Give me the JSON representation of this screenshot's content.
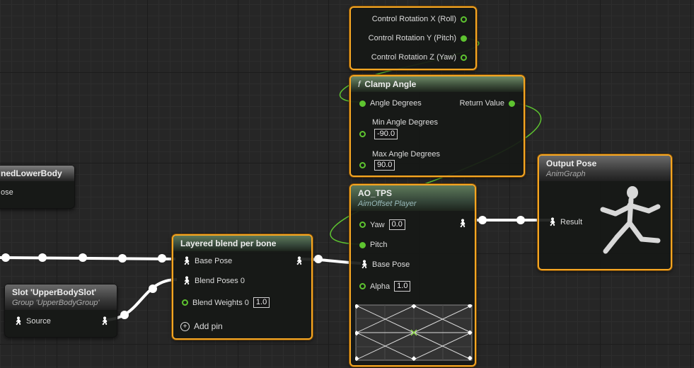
{
  "nodes": {
    "control_rotation": {
      "pins": [
        "Control Rotation X (Roll)",
        "Control Rotation Y (Pitch)",
        "Control Rotation Z (Yaw)"
      ]
    },
    "clamp_angle": {
      "title": "Clamp Angle",
      "function_glyph": "f",
      "angle_degrees": "Angle Degrees",
      "return_value": "Return Value",
      "min_label": "Min Angle Degrees",
      "min_value": "-90.0",
      "max_label": "Max Angle Degrees",
      "max_value": "90.0"
    },
    "lower_body": {
      "title": "nedLowerBody",
      "pin": "ose"
    },
    "output_pose": {
      "title": "Output Pose",
      "subtitle": "AnimGraph",
      "result": "Result"
    },
    "ao_tps": {
      "title": "AO_TPS",
      "subtitle": "AimOffset Player",
      "yaw_label": "Yaw",
      "yaw_value": "0.0",
      "pitch_label": "Pitch",
      "base_pose": "Base Pose",
      "alpha_label": "Alpha",
      "alpha_value": "1.0"
    },
    "layered_blend": {
      "title": "Layered blend per bone",
      "base_pose": "Base Pose",
      "blend_poses": "Blend Poses 0",
      "blend_weights": "Blend Weights 0",
      "blend_weights_value": "1.0",
      "add_pin": "Add pin"
    },
    "slot": {
      "title": "Slot 'UpperBodySlot'",
      "subtitle": "Group 'UpperBodyGroup'",
      "source": "Source"
    }
  },
  "icons": {
    "pose_pin": "person-figure-icon",
    "add": "plus-circle-icon",
    "function": "function-icon"
  },
  "colors": {
    "exec_wire": "#ffffff",
    "float_wire": "#5ec430",
    "selection": "#f5a623",
    "header_green": "#4f6a4a",
    "header_grey": "#555555"
  }
}
